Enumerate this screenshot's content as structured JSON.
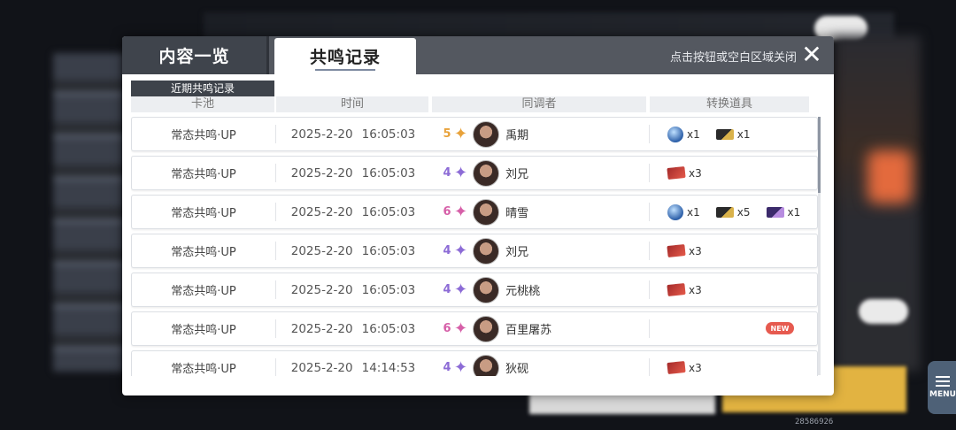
{
  "header": {
    "tab_overview": "内容一览",
    "tab_records": "共鸣记录",
    "close_hint": "点击按钮或空白区域关闭",
    "close_glyph": "✕"
  },
  "section_label": "近期共鸣记录",
  "columns": {
    "pool": "卡池",
    "time": "时间",
    "resonator": "同调者",
    "items": "转换道具"
  },
  "rows": [
    {
      "pool": "常态共鸣·UP",
      "date": "2025-2-20",
      "clock": "16:05:03",
      "rarity": "5",
      "star_color": "#e8a23a",
      "name": "禹期",
      "items": [
        {
          "icon": "blue-orb-icon",
          "qty": "x1"
        },
        {
          "icon": "gold-ticket-icon",
          "qty": "x1"
        }
      ],
      "new": ""
    },
    {
      "pool": "常态共鸣·UP",
      "date": "2025-2-20",
      "clock": "16:05:03",
      "rarity": "4",
      "star_color": "#8c6bd6",
      "name": "刘兄",
      "items": [
        {
          "icon": "red-ticket-icon",
          "qty": "x3"
        }
      ],
      "new": ""
    },
    {
      "pool": "常态共鸣·UP",
      "date": "2025-2-20",
      "clock": "16:05:03",
      "rarity": "6",
      "star_color": "#d65fa8",
      "name": "晴雪",
      "items": [
        {
          "icon": "blue-orb-icon",
          "qty": "x1"
        },
        {
          "icon": "gold-ticket-icon",
          "qty": "x5"
        },
        {
          "icon": "purple-ticket-icon",
          "qty": "x1"
        }
      ],
      "new": ""
    },
    {
      "pool": "常态共鸣·UP",
      "date": "2025-2-20",
      "clock": "16:05:03",
      "rarity": "4",
      "star_color": "#8c6bd6",
      "name": "刘兄",
      "items": [
        {
          "icon": "red-ticket-icon",
          "qty": "x3"
        }
      ],
      "new": ""
    },
    {
      "pool": "常态共鸣·UP",
      "date": "2025-2-20",
      "clock": "16:05:03",
      "rarity": "4",
      "star_color": "#8c6bd6",
      "name": "元桃桃",
      "items": [
        {
          "icon": "red-ticket-icon",
          "qty": "x3"
        }
      ],
      "new": ""
    },
    {
      "pool": "常态共鸣·UP",
      "date": "2025-2-20",
      "clock": "16:05:03",
      "rarity": "6",
      "star_color": "#d65fa8",
      "name": "百里屠苏",
      "items": [],
      "new": "NEW"
    },
    {
      "pool": "常态共鸣·UP",
      "date": "2025-2-20",
      "clock": "14:14:53",
      "rarity": "4",
      "star_color": "#8c6bd6",
      "name": "狄砚",
      "items": [
        {
          "icon": "red-ticket-icon",
          "qty": "x3"
        }
      ],
      "new": ""
    }
  ],
  "menu_label": "MENU",
  "uid": "28586926"
}
